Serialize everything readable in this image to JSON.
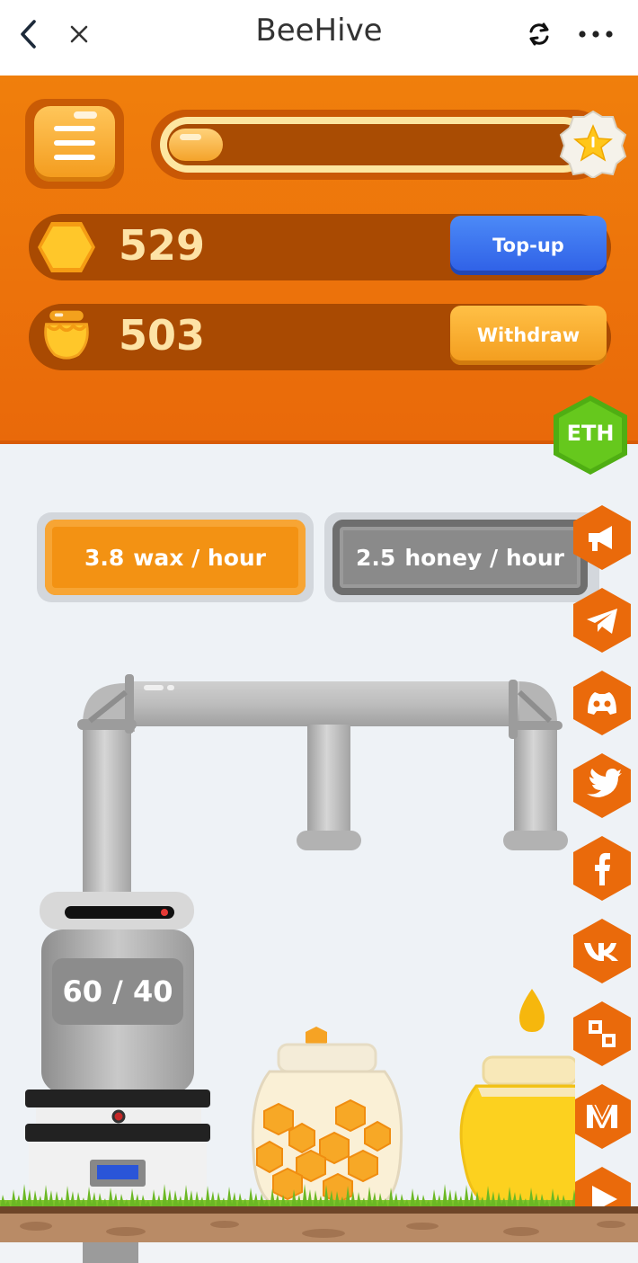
{
  "navbar": {
    "title": "BeeHive"
  },
  "header": {
    "xp_progress": 0.13,
    "wax_balance": "529",
    "honey_balance": "503",
    "topup_label": "Top-up",
    "withdraw_label": "Withdraw",
    "network_badge": "ETH"
  },
  "rates": {
    "wax_value": "3.8",
    "wax_unit": "wax / hour",
    "honey_value": "2.5",
    "honey_unit": "honey / hour"
  },
  "machine": {
    "counter": "60 / 40"
  },
  "social_links": [
    {
      "name": "announcements",
      "icon": "megaphone-icon"
    },
    {
      "name": "telegram",
      "icon": "telegram-icon"
    },
    {
      "name": "discord",
      "icon": "discord-icon"
    },
    {
      "name": "twitter",
      "icon": "twitter-icon"
    },
    {
      "name": "facebook",
      "icon": "facebook-icon"
    },
    {
      "name": "vk",
      "icon": "vk-icon"
    },
    {
      "name": "checker",
      "icon": "checker-icon"
    },
    {
      "name": "medium",
      "icon": "medium-icon"
    },
    {
      "name": "video",
      "icon": "play-icon"
    }
  ],
  "colors": {
    "header_orange": "#f07f0c",
    "accent_blue": "#2e5fe6",
    "eth_green": "#5cc31a",
    "social_orange": "#ea6a0b"
  }
}
